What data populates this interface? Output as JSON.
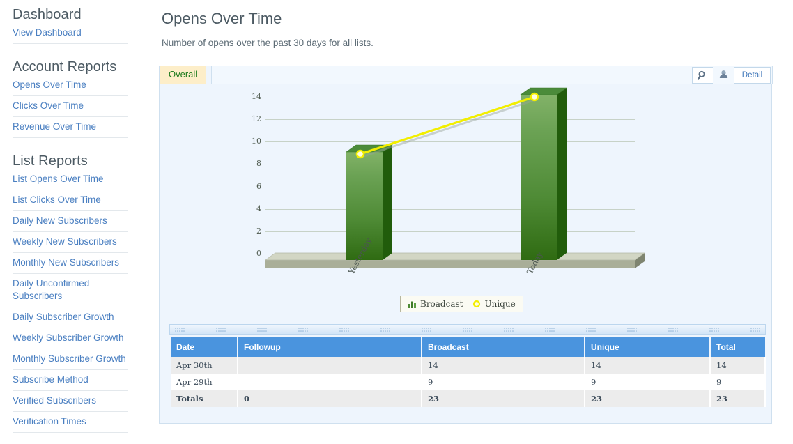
{
  "sidebar": {
    "sections": [
      {
        "heading": "Dashboard",
        "items": [
          {
            "label": "View Dashboard"
          }
        ]
      },
      {
        "heading": "Account Reports",
        "items": [
          {
            "label": "Opens Over Time"
          },
          {
            "label": "Clicks Over Time"
          },
          {
            "label": "Revenue Over Time"
          }
        ]
      },
      {
        "heading": "List Reports",
        "items": [
          {
            "label": "List Opens Over Time"
          },
          {
            "label": "List Clicks Over Time"
          },
          {
            "label": "Daily New Subscribers"
          },
          {
            "label": "Weekly New Subscribers"
          },
          {
            "label": "Monthly New Subscribers"
          },
          {
            "label": "Daily Unconfirmed Subscribers"
          },
          {
            "label": "Daily Subscriber Growth"
          },
          {
            "label": "Weekly Subscriber Growth"
          },
          {
            "label": "Monthly Subscriber Growth"
          },
          {
            "label": "Subscribe Method"
          },
          {
            "label": "Verified Subscribers"
          },
          {
            "label": "Verification Times"
          }
        ]
      }
    ]
  },
  "header": {
    "title": "Opens Over Time",
    "subtitle": "Number of opens over the past 30 days for all lists."
  },
  "toolbar": {
    "tab_overall": "Overall",
    "zoom_icon": "magnifier-icon",
    "user_icon": "person-icon",
    "detail_label": "Detail"
  },
  "chart_data": {
    "type": "bar",
    "title": "Opens Over Time",
    "categories": [
      "Yesterday",
      "Today"
    ],
    "series": [
      {
        "name": "Broadcast",
        "type": "bar",
        "values": [
          9,
          14
        ],
        "color": "#4f8b36"
      },
      {
        "name": "Unique",
        "type": "line",
        "values": [
          9,
          14
        ],
        "color": "#f5f000"
      }
    ],
    "yticks": [
      0,
      2,
      4,
      6,
      8,
      10,
      12,
      14
    ],
    "ylim": [
      0,
      14
    ],
    "xlabel": "",
    "ylabel": "",
    "grid": true,
    "legend_position": "bottom",
    "legend": [
      {
        "label": "Broadcast",
        "marker": "bar-icon",
        "color": "#4f8b36"
      },
      {
        "label": "Unique",
        "marker": "circle-icon",
        "color": "#f5f000"
      }
    ]
  },
  "table": {
    "columns": [
      "Date",
      "Followup",
      "Broadcast",
      "Unique",
      "Total"
    ],
    "rows": [
      {
        "date": "Apr 30th",
        "followup": "",
        "broadcast": "14",
        "unique": "14",
        "total": "14"
      },
      {
        "date": "Apr 29th",
        "followup": "",
        "broadcast": "9",
        "unique": "9",
        "total": "9"
      },
      {
        "date": "Totals",
        "followup": "0",
        "broadcast": "23",
        "unique": "23",
        "total": "23"
      }
    ]
  },
  "colors": {
    "accent_blue": "#4a94de",
    "link_blue": "#4a7fc1",
    "bar_green": "#4f8b36",
    "line_yellow": "#f5f000",
    "panel_bg": "#eef5fd",
    "tab_yellow": "#fdeec9"
  }
}
